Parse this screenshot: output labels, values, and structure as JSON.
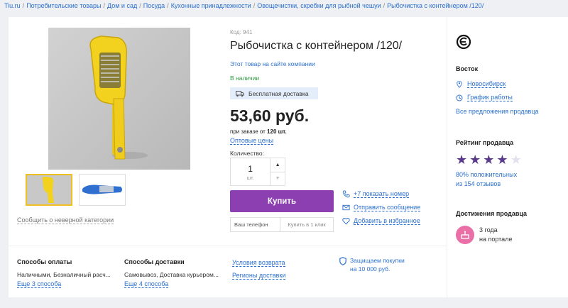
{
  "breadcrumbs": [
    "Tiu.ru",
    "Потребительские товары",
    "Дом и сад",
    "Посуда",
    "Кухонные принадлежности",
    "Овощечистки, скребки для рыбной чешуи",
    "Рыбочистка с контейнером /120/"
  ],
  "gallery": {
    "report_link": "Сообщить о неверной категории"
  },
  "product": {
    "code": "Код: 941",
    "title": "Рыбочистка с контейнером /120/",
    "site_link": "Этот товар на сайте компании",
    "stock": "В наличии",
    "shipping_badge": "Бесплатная доставка",
    "price": "53,60 руб.",
    "min_order_prefix": "при заказе от",
    "min_order_value": "120 шт.",
    "wholesale_link": "Оптовые цены",
    "quantity_label": "Количество:",
    "quantity_value": "1",
    "quantity_unit": "шт.",
    "buy_label": "Купить",
    "phone_placeholder": "Ваш телефон",
    "one_click_label": "Купить в 1 клик"
  },
  "actions": {
    "show_phone": "+7 показать номер",
    "send_message": "Отправить сообщение",
    "add_favorite": "Добавить в избранное"
  },
  "bottom": {
    "payment": {
      "title": "Способы оплаты",
      "text": "Наличными, Безналичный расч...",
      "more": "Еще 3 способа"
    },
    "delivery": {
      "title": "Способы доставки",
      "text": "Самовывоз, Доставка курьером...",
      "more": "Еще 4 способа"
    },
    "links": {
      "return": "Условия возврата",
      "regions": "Регионы доставки"
    },
    "protection": {
      "line1": "Защищаем покупки",
      "line2": "на 10 000 руб."
    }
  },
  "seller": {
    "name": "Восток",
    "city": "Новосибирск",
    "schedule": "График работы",
    "all_offers": "Все предложения продавца",
    "rating_title": "Рейтинг продавца",
    "rating_stars": 4,
    "rating_max": 5,
    "positive_line1": "80% положительных",
    "positive_line2": "из 154 отзывов",
    "achievements_title": "Достижения продавца",
    "achievement_line1": "3 года",
    "achievement_line2": "на портале"
  },
  "colors": {
    "accent": "#8b3fb0",
    "link": "#2a6fcf",
    "star_active": "#5a3a8c",
    "star_inactive": "#e4e0ee",
    "stock_green": "#2c9c3c",
    "achievement_pink": "#e96fa6"
  }
}
